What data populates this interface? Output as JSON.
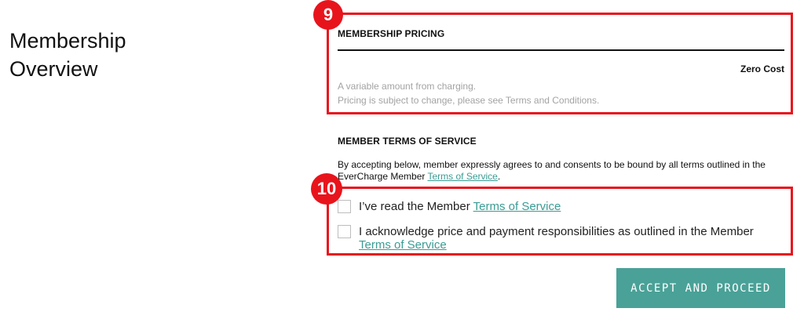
{
  "page": {
    "title": "Membership Overview"
  },
  "annotations": {
    "badge_9": "9",
    "badge_10": "10",
    "color": "#e8141c"
  },
  "pricing": {
    "heading": "MEMBERSHIP PRICING",
    "price": "Zero Cost",
    "note_1": "A variable amount from charging.",
    "note_2": "Pricing is subject to change, please see Terms and Conditions."
  },
  "tos": {
    "heading": "MEMBER TERMS OF SERVICE",
    "text_before": "By accepting below, member expressly agrees to and consents to be bound by all terms outlined in the EverCharge Member ",
    "link": "Terms of Service",
    "text_after": "."
  },
  "checkboxes": [
    {
      "text": "I’ve read the Member ",
      "link": "Terms of Service",
      "checked": false
    },
    {
      "text": "I acknowledge price and payment responsibilities as outlined in the Member ",
      "link": "Terms of Service",
      "checked": false
    }
  ],
  "actions": {
    "accept_label": "ACCEPT AND PROCEED",
    "accent": "#4aa197"
  }
}
